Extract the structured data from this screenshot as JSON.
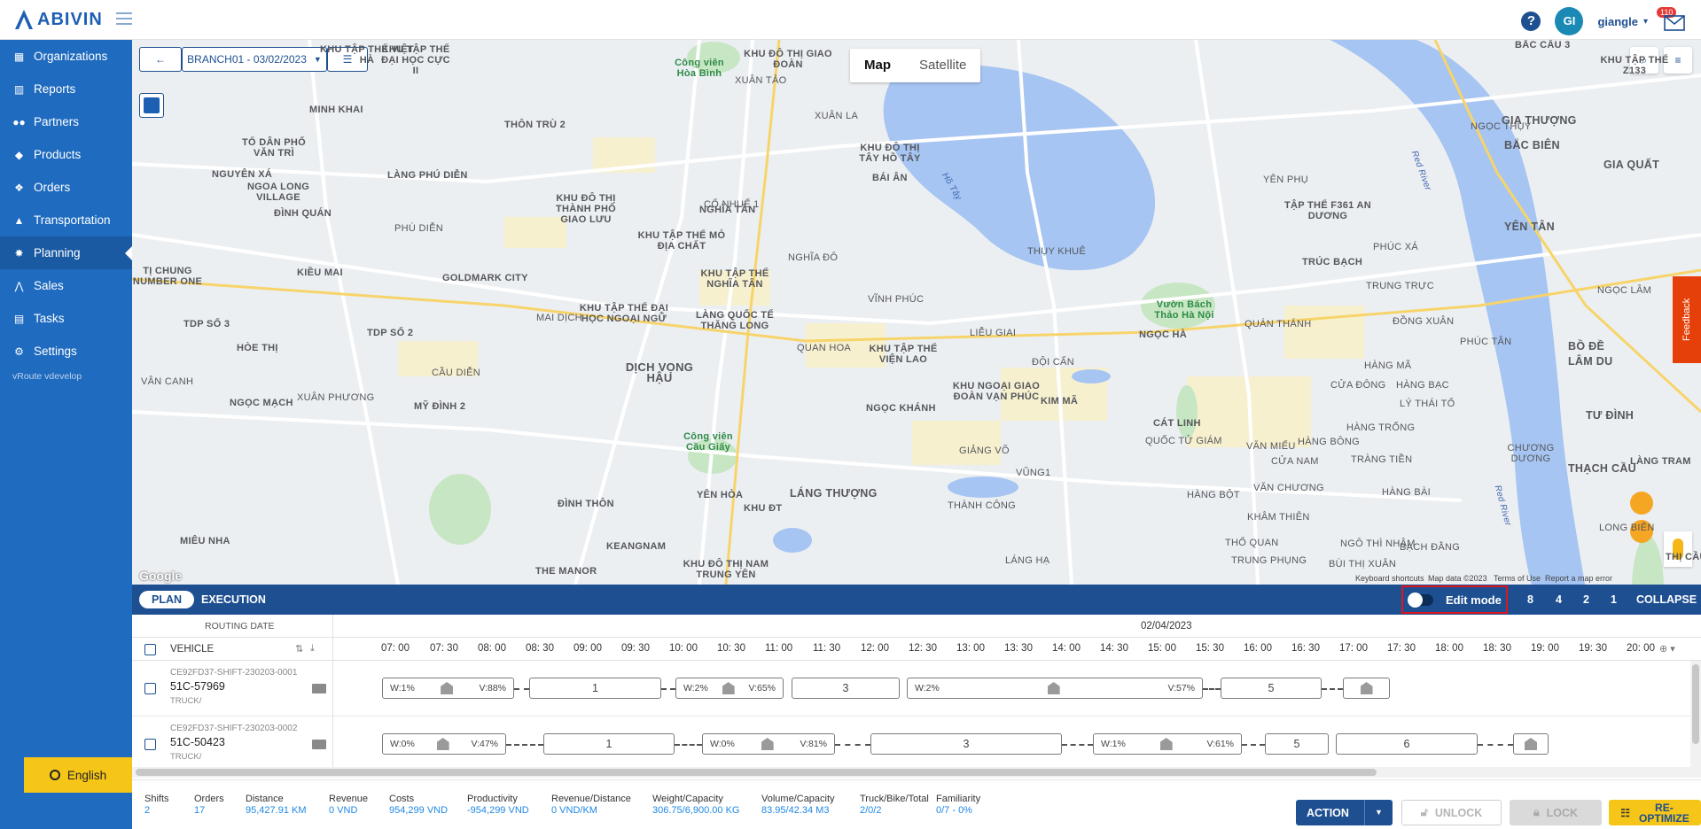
{
  "app": {
    "logo": "ABIVIN",
    "user_initials": "GI",
    "user_name": "giangle",
    "notifications": "110"
  },
  "sidebar": {
    "items": [
      {
        "label": "Organizations",
        "icon": "building-icon"
      },
      {
        "label": "Reports",
        "icon": "chart-icon"
      },
      {
        "label": "Partners",
        "icon": "users-icon"
      },
      {
        "label": "Products",
        "icon": "boxes-icon"
      },
      {
        "label": "Orders",
        "icon": "cubes-icon"
      },
      {
        "label": "Transportation",
        "icon": "truck-icon"
      },
      {
        "label": "Planning",
        "icon": "route-icon"
      },
      {
        "label": "Sales",
        "icon": "sales-icon"
      },
      {
        "label": "Tasks",
        "icon": "calendar-icon"
      },
      {
        "label": "Settings",
        "icon": "gear-icon"
      }
    ],
    "version": "vRoute vdevelop",
    "language": "English"
  },
  "map": {
    "branch_select": "BRANCH01 - 03/02/2023",
    "map_type": "Map",
    "satellite": "Satellite",
    "attribution": "Keyboard shortcuts",
    "map_data": "Map data ©2023",
    "terms": "Terms of Use",
    "report": "Report a map error",
    "google": "Google",
    "feedback": "Feedback",
    "labels": {
      "a": "NGHĨA TÂN",
      "b": "KHU TẬP THỂ VIỆT HÀ",
      "c": "MINH KHAI",
      "d": "TỔ DÂN PHỐ VĂN TRÌ",
      "e": "NGUYÊN XÁ",
      "f": "NGOA LONG VILLAGE",
      "g": "ĐÌNH QUÁN",
      "h": "LÀNG PHÚ DIỄN",
      "i": "PHÚ DIỄN",
      "j": "KIỀU MAI",
      "k": "GOLDMARK CITY",
      "l": "TDP SỐ 3",
      "m": "TDP SỐ 2",
      "n": "HÒE THỊ",
      "o": "TÍ CHUNG",
      "p": "VÂN CANH",
      "q": "NGỌC MẠCH",
      "r": "XUÂN PHƯƠNG",
      "s": "MỸ ĐÌNH 2",
      "t": "MIÊU NHA",
      "u": "KHU ĐÔ THỊ THÀNH PHỐ GIAO LƯU",
      "v": "KHU TẬP THỂ MỎ ĐỊA CHẤT",
      "w": "KHU TẬP THỂ NGHĨA TÂN",
      "x": "KHU TẬP THỂ ĐẠI HỌC NGOẠI NGỮ",
      "y": "LÀNG QUỐC TẾ THĂNG LONG",
      "z": "DỊCH VỌNG HẬU",
      "aa": "Công viên Cầu Giấy",
      "ab": "ĐÌNH THÔN",
      "ac": "YÊN HÒA",
      "ad": "KEANGNAM",
      "ae": "THE MANOR",
      "af": "KHU ĐÔ THỊ NAM TRUNG YÊN",
      "ag": "LÁNG THƯỢNG",
      "ah": "KHU ĐT",
      "ai": "KHU ĐÔ THỊ TÂY HỒ TÂY",
      "aj": "BÁI ÂN",
      "ak": "KHU TẬP THỂ VIỆN LAO",
      "al": "QUAN HOA",
      "am": "KHU NGOẠI GIAO ĐOÀN VẠN PHÚC",
      "an": "KIM MÃ",
      "ao": "NGỌC KHÁNH",
      "ap": "GIẢNG VÕ",
      "aq": "LIỄU GIAI",
      "ar": "VĨNH PHÚC",
      "as": "THÀNH CÔNG",
      "at": "LÁNG HẠ",
      "au": "Vườn Bách Thảo Hà Nội",
      "av": "TẬP THỂ F361 AN DƯƠNG",
      "aw": "YÊN PHỤ",
      "ax": "QUÁN THÁNH",
      "ay": "NGỌC HÀ",
      "az": "ĐỘI CẤN",
      "ba": "CÁT LINH",
      "bb": "VĂN MIẾU",
      "bc": "QUỐC TỬ GIÁM",
      "bd": "CỬA NAM",
      "be": "HÀNG BỘT",
      "bf": "VĂN CHƯƠNG",
      "bg": "KHÂM THIÊN",
      "bh": "THỔ QUAN",
      "bi": "TRUNG PHỤNG",
      "bj": "TRÚC BẠCH",
      "bk": "HÀNG BÔNG",
      "bl": "CỬA ĐÔNG",
      "bm": "HÀNG MÃ",
      "bn": "HÀNG BẠC",
      "bo": "LÝ THÁI TỔ",
      "bp": "HÀNG TRỐNG",
      "bq": "TRÀNG TIỀN",
      "br": "HÀNG BÀI",
      "bs": "NGÔ THÌ NHẬM",
      "bt": "BÙI THỊ XUÂN",
      "bu": "PHÚC XÁ",
      "bv": "TRUNG TRỰC",
      "bw": "ĐỒNG XUÂN",
      "bx": "PHÚC TÂN",
      "by": "CHƯƠNG DƯƠNG",
      "bz": "BẠCH ĐẰNG",
      "ca": "BỒ ĐỀ",
      "cb": "LÂM DU",
      "cc": "NGỌC THỤY",
      "cd": "BẮC CẦU 3",
      "ce": "KHU TẬP THỂ Z133",
      "cf": "GIA THƯỢNG",
      "cg": "BẮC BIÊN",
      "ch": "GIA QUẤT",
      "ci": "YÊN TÂN",
      "cj": "NGỌC LÂM",
      "ck": "TƯ ĐÌNH",
      "cl": "THẠCH CẦU",
      "cm": "LONG BIÊN",
      "cn": "Hồ Tây",
      "co": "THỤY KHUÊ",
      "cp": "Red River",
      "cq": "KHU ĐÔ THỊ GIAO ĐOÀN",
      "cr": "XUÂN LA",
      "cs": "XUÂN TẢO",
      "ct": "THÔN TRÙ 2",
      "cu": "CỔ NHUẾ 1",
      "cv": "NGHĨA ĐÔ",
      "cw": "MAI DỊCH",
      "cx": "CẦU DIỄN",
      "cy": "TỊ CHUNG NUMBER ONE",
      "cz": "Công viên Hòa Bình",
      "da": "LÀNG TRAM",
      "db": "THỊ CẦU",
      "dc": "KHU TẬP THỂ ĐẠI HỌC CỰC II",
      "dd": "BẠCH ĐẰNG",
      "de": "VŨNG1"
    }
  },
  "plan_bar": {
    "plan": "PLAN",
    "execution": "EXECUTION",
    "edit_mode": "Edit mode",
    "s1": "8",
    "s2": "4",
    "s3": "2",
    "s4": "1",
    "collapse": "COLLAPSE"
  },
  "timeline": {
    "routing_date_label": "ROUTING DATE",
    "date": "02/04/2023",
    "vehicle_label": "VEHICLE",
    "times": [
      "07: 00",
      "07: 30",
      "08: 00",
      "08: 30",
      "09: 00",
      "09: 30",
      "10: 00",
      "10: 30",
      "11: 00",
      "11: 30",
      "12: 00",
      "12: 30",
      "13: 00",
      "13: 30",
      "14: 00",
      "14: 30",
      "15: 00",
      "15: 30",
      "16: 00",
      "16: 30",
      "17: 00",
      "17: 30",
      "18: 00",
      "18: 30",
      "19: 00",
      "19: 30",
      "20: 00"
    ],
    "rows": [
      {
        "id": "CE92FD37-SHIFT-230203-0001",
        "plate": "51C-57969",
        "type": "TRUCK/",
        "w1": "W:1%",
        "v1": "V:88%",
        "s1": "1",
        "w2": "W:2%",
        "v2": "V:65%",
        "s2": "3",
        "w3": "W:2%",
        "v3": "V:57%",
        "s3": "5"
      },
      {
        "id": "CE92FD37-SHIFT-230203-0002",
        "plate": "51C-50423",
        "type": "TRUCK/",
        "w1": "W:0%",
        "v1": "V:47%",
        "s1": "1",
        "w2": "W:0%",
        "v2": "V:81%",
        "s2": "3",
        "w3": "W:1%",
        "v3": "V:61%",
        "s3": "5",
        "s4": "6"
      }
    ]
  },
  "footer": {
    "stats": [
      {
        "label": "Shifts",
        "value": "2"
      },
      {
        "label": "Orders",
        "value": "17"
      },
      {
        "label": "Distance",
        "value": "95,427.91 KM"
      },
      {
        "label": "Revenue",
        "value": "0 VND"
      },
      {
        "label": "Costs",
        "value": "954,299 VND"
      },
      {
        "label": "Productivity",
        "value": "-954,299 VND"
      },
      {
        "label": "Revenue/Distance",
        "value": "0 VND/KM"
      },
      {
        "label": "Weight/Capacity",
        "value": "306.75/6,900.00 KG"
      },
      {
        "label": "Volume/Capacity",
        "value": "83.95/42.34 M3"
      },
      {
        "label": "Truck/Bike/Total",
        "value": "2/0/2"
      },
      {
        "label": "Familiarity",
        "value": "0/7 - 0%"
      }
    ],
    "action": "ACTION",
    "unlock": "UNLOCK",
    "lock": "LOCK",
    "reoptimize_1": "RE-",
    "reoptimize_2": "OPTIMIZE"
  },
  "colors": {
    "brand": "#1f6bbf",
    "dark": "#1d4f91",
    "accent": "#f5c518",
    "alert": "#e0141e"
  }
}
